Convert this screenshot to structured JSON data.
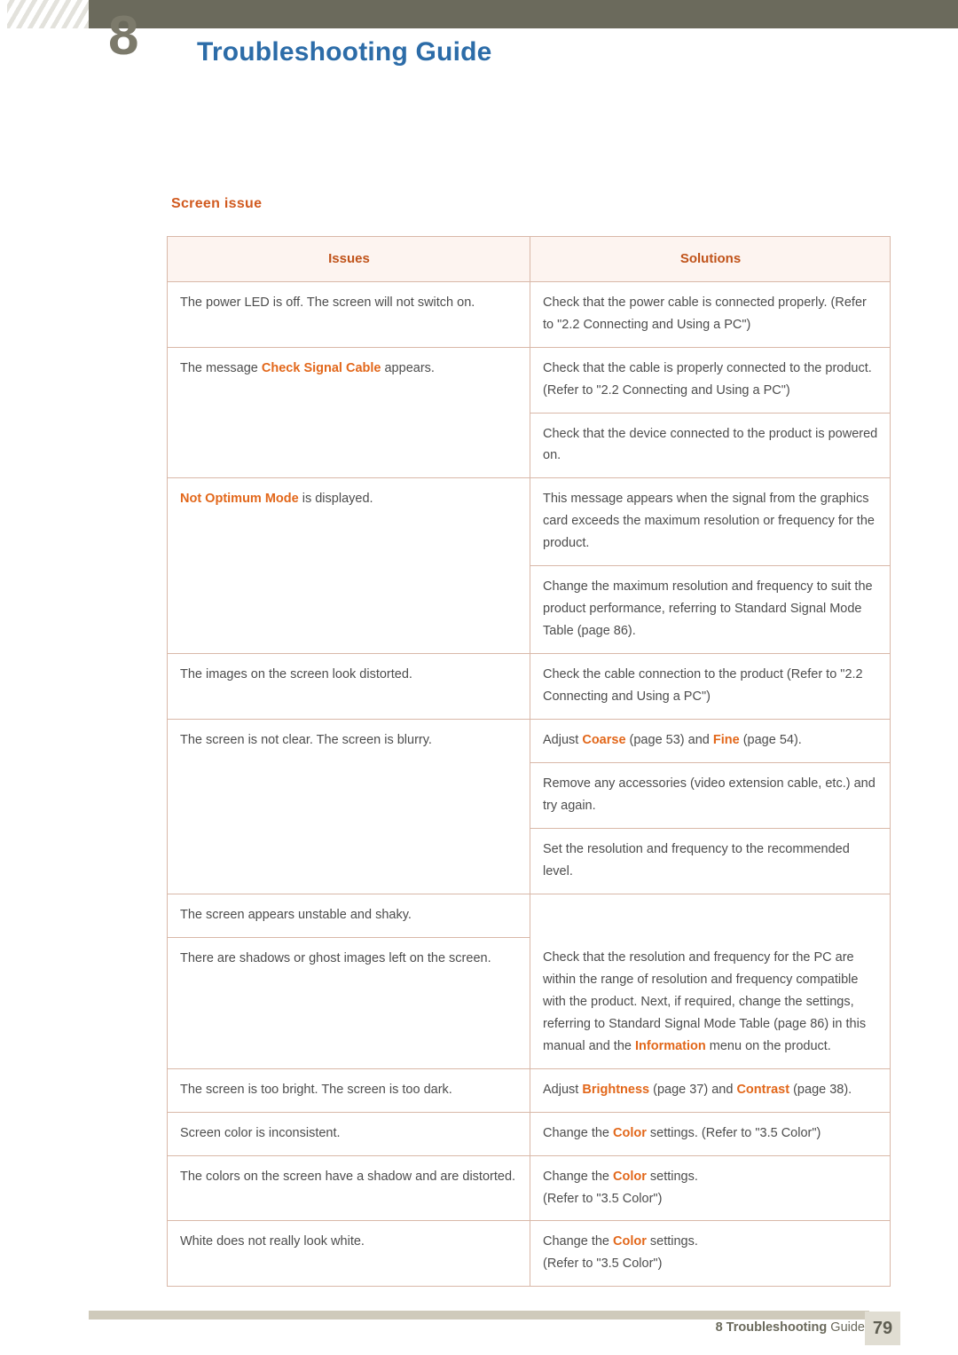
{
  "header": {
    "chapter_number": "8",
    "title": "Troubleshooting Guide"
  },
  "section": {
    "title": "Screen issue"
  },
  "table": {
    "headers": {
      "issues": "Issues",
      "solutions": "Solutions"
    },
    "rows": [
      {
        "issue_pre": "The power LED is off. The screen will not switch on.",
        "issue_hl": "",
        "issue_post": "",
        "solution": "Check that the power cable is connected properly. (Refer to \"2.2 Connecting and Using a PC\")"
      },
      {
        "issue_pre": "The message ",
        "issue_hl": "Check Signal Cable",
        "issue_post": " appears.",
        "solution": "Check that the cable is properly connected to the product. (Refer to \"2.2 Connecting and Using a PC\")"
      },
      {
        "issue_pre": "",
        "issue_hl": "",
        "issue_post": "",
        "solution": "Check that the device connected to the product is powered on."
      },
      {
        "issue_pre": "",
        "issue_hl": "Not Optimum Mode",
        "issue_post": " is displayed.",
        "solution": "This message appears when the signal from the graphics card exceeds the maximum resolution or frequency for the product."
      },
      {
        "issue_pre": "",
        "issue_hl": "",
        "issue_post": "",
        "solution": "Change the maximum resolution and frequency to suit the product performance, referring to Standard Signal Mode Table (page 86)."
      },
      {
        "issue_pre": "The images on the screen look distorted.",
        "issue_hl": "",
        "issue_post": "",
        "solution": "Check the cable connection to the product (Refer to \"2.2 Connecting and Using a PC\")"
      },
      {
        "issue_pre": "The screen is not clear. The screen is blurry.",
        "issue_hl": "",
        "issue_post": "",
        "solution_parts": [
          {
            "text": "Adjust ",
            "hl": false
          },
          {
            "text": "Coarse",
            "hl": true
          },
          {
            "text": " (page 53) and ",
            "hl": false
          },
          {
            "text": "Fine",
            "hl": true
          },
          {
            "text": " (page 54).",
            "hl": false
          }
        ]
      },
      {
        "issue_pre": "",
        "issue_hl": "",
        "issue_post": "",
        "solution": "Remove any accessories (video extension cable, etc.) and try again."
      },
      {
        "issue_pre": "",
        "issue_hl": "",
        "issue_post": "",
        "solution": "Set the resolution and frequency to the recommended level."
      },
      {
        "issue_pre": "The screen appears unstable and shaky.",
        "issue_hl": "",
        "issue_post": "",
        "solution": ""
      },
      {
        "issue_pre": "There are shadows or ghost images left on the screen.",
        "issue_hl": "",
        "issue_post": "",
        "solution_parts": [
          {
            "text": "Check that the resolution and frequency for the PC are within the range of resolution and frequency compatible with the product. Next, if required, change the settings, referring to Standard Signal Mode Table (page 86) in this manual and the ",
            "hl": false
          },
          {
            "text": "Information",
            "hl": true
          },
          {
            "text": " menu on the product.",
            "hl": false
          }
        ]
      },
      {
        "issue_pre": "The screen is too bright. The screen is too dark.",
        "issue_hl": "",
        "issue_post": "",
        "solution_parts": [
          {
            "text": "Adjust ",
            "hl": false
          },
          {
            "text": "Brightness",
            "hl": true
          },
          {
            "text": " (page 37) and ",
            "hl": false
          },
          {
            "text": "Contrast",
            "hl": true
          },
          {
            "text": " (page 38).",
            "hl": false
          }
        ]
      },
      {
        "issue_pre": "Screen color is inconsistent.",
        "issue_hl": "",
        "issue_post": "",
        "solution_parts": [
          {
            "text": "Change the ",
            "hl": false
          },
          {
            "text": "Color",
            "hl": true
          },
          {
            "text": " settings. (Refer to \"3.5 Color\")",
            "hl": false
          }
        ]
      },
      {
        "issue_pre": "The colors on the screen have a shadow and are distorted.",
        "issue_hl": "",
        "issue_post": "",
        "solution_parts": [
          {
            "text": "Change the ",
            "hl": false
          },
          {
            "text": "Color",
            "hl": true
          },
          {
            "text": " settings.\n(Refer to \"3.5 Color\")",
            "hl": false
          }
        ]
      },
      {
        "issue_pre": "White does not really look white.",
        "issue_hl": "",
        "issue_post": "",
        "solution_parts": [
          {
            "text": "Change the ",
            "hl": false
          },
          {
            "text": "Color",
            "hl": true
          },
          {
            "text": " settings.\n(Refer to \"3.5 Color\")",
            "hl": false
          }
        ]
      }
    ]
  },
  "footer": {
    "chapter_label": "8 Troubleshooting Guide",
    "chapter_bold": "8 Troubleshooting",
    "chapter_rest": " Guide",
    "page_number": "79"
  },
  "colors": {
    "heading_blue": "#2c6ca8",
    "accent_orange": "#e2671a",
    "section_orange": "#d15a1f",
    "header_bar": "#6b6a5c",
    "table_border": "#d9b8a8",
    "table_header_bg": "#fdf4f0"
  }
}
